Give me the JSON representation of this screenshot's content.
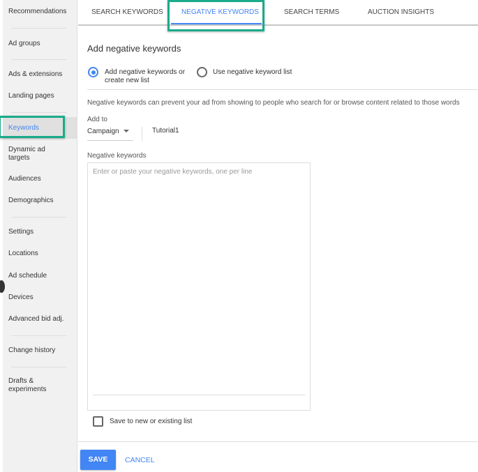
{
  "sidebar": {
    "items": [
      "Recommendations",
      "Ad groups",
      "Ads & extensions",
      "Landing pages",
      "Keywords",
      "Dynamic ad targets",
      "Audiences",
      "Demographics",
      "Settings",
      "Locations",
      "Ad schedule",
      "Devices",
      "Advanced bid adj.",
      "Change history",
      "Drafts & experiments"
    ],
    "active": "Keywords"
  },
  "tabs": [
    "SEARCH KEYWORDS",
    "NEGATIVE KEYWORDS",
    "SEARCH TERMS",
    "AUCTION INSIGHTS"
  ],
  "active_tab": "NEGATIVE KEYWORDS",
  "form": {
    "title": "Add negative keywords",
    "radio1": "Add negative keywords or create new list",
    "radio2": "Use negative keyword list",
    "radio_selected": "radio1",
    "description": "Negative keywords can prevent your ad from showing to people who search for or browse content related to those words",
    "add_to_label": "Add to",
    "add_to_value": "Campaign",
    "campaign_name": "Tutorial1",
    "keywords_label": "Negative keywords",
    "keywords_placeholder": "Enter or paste your negative keywords, one per line",
    "keywords_value": "",
    "save_list_label": "Save to new or existing list",
    "save_list_checked": false
  },
  "actions": {
    "save": "SAVE",
    "cancel": "CANCEL"
  },
  "colors": {
    "accent": "#4285f4",
    "highlight": "#1aab8a"
  }
}
